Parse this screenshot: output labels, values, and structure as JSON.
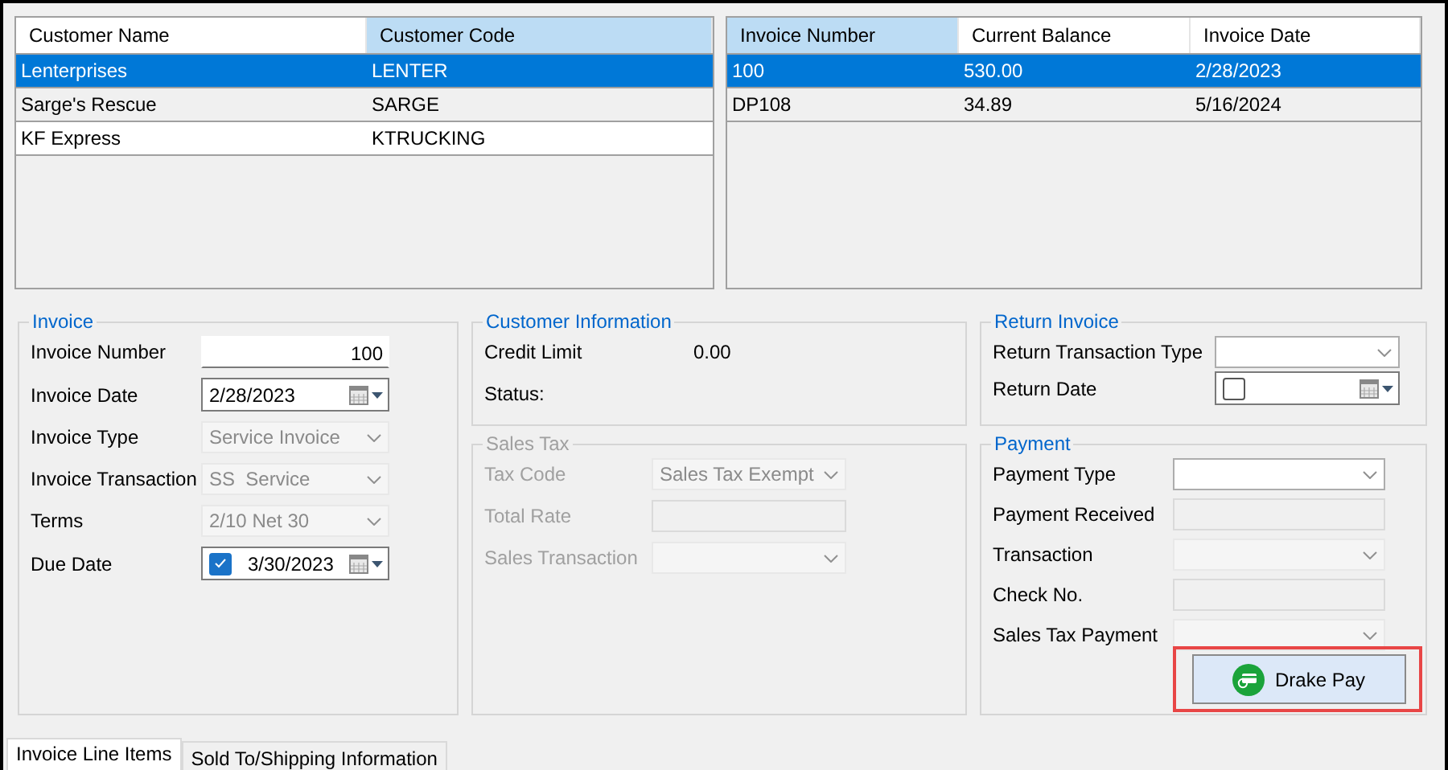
{
  "customer_grid": {
    "columns": [
      {
        "label": "Customer Name",
        "selected": false
      },
      {
        "label": "Customer Code",
        "selected": true
      }
    ],
    "rows": [
      {
        "cells": [
          "Lenterprises",
          "LENTER"
        ],
        "selected": true
      },
      {
        "cells": [
          "Sarge's Rescue",
          "SARGE"
        ],
        "selected": false
      },
      {
        "cells": [
          "KF Express",
          "KTRUCKING"
        ],
        "selected": false
      }
    ]
  },
  "invoice_grid": {
    "columns": [
      {
        "label": "Invoice Number",
        "selected": true
      },
      {
        "label": "Current Balance",
        "selected": false
      },
      {
        "label": "Invoice Date",
        "selected": false
      }
    ],
    "rows": [
      {
        "cells": [
          "100",
          "530.00",
          "2/28/2023"
        ],
        "selected": true
      },
      {
        "cells": [
          "DP108",
          "34.89",
          "5/16/2024"
        ],
        "selected": false
      }
    ]
  },
  "invoice": {
    "title": "Invoice",
    "disabled": false,
    "fields": [
      {
        "label": "Invoice Number",
        "kind": "text",
        "value": "100",
        "disabled": false
      },
      {
        "label": "Invoice Date",
        "kind": "date",
        "value": "2/28/2023",
        "disabled": false
      },
      {
        "label": "Invoice Type",
        "kind": "combo",
        "value": "Service Invoice",
        "disabled": true
      },
      {
        "label": "Invoice Transaction",
        "kind": "combo",
        "value": "SS  Service",
        "disabled": true
      },
      {
        "label": "Terms",
        "kind": "combo",
        "value": "2/10 Net 30",
        "disabled": true
      },
      {
        "label": "Due Date",
        "kind": "date",
        "value": "3/30/2023",
        "checked": true,
        "disabled": false
      }
    ]
  },
  "customer_information": {
    "title": "Customer Information",
    "disabled": false,
    "fields": [
      {
        "label": "Credit Limit",
        "kind": "value",
        "value": "0.00"
      },
      {
        "label": "Status:",
        "kind": "value"
      }
    ]
  },
  "sales_tax": {
    "title": "Sales Tax",
    "disabled": true,
    "fields": [
      {
        "label": "Tax Code",
        "kind": "combo",
        "value": "Sales Tax Exempt",
        "disabled": true
      },
      {
        "label": "Total Rate",
        "kind": "text",
        "disabled": true
      },
      {
        "label": "Sales Transaction",
        "kind": "combo",
        "disabled": true
      }
    ]
  },
  "return_invoice": {
    "title": "Return Invoice",
    "disabled": false,
    "fields": [
      {
        "label": "Return Transaction Type",
        "kind": "combo",
        "disabled": false
      },
      {
        "label": "Return Date",
        "kind": "date",
        "checked": false,
        "disabled": false
      }
    ]
  },
  "payment": {
    "title": "Payment",
    "disabled": false,
    "fields": [
      {
        "label": "Payment Type",
        "kind": "combo",
        "disabled": false
      },
      {
        "label": "Payment Received",
        "kind": "text",
        "disabled": true
      },
      {
        "label": "Transaction",
        "kind": "combo",
        "disabled": true
      },
      {
        "label": "Check No.",
        "kind": "text",
        "disabled": true
      },
      {
        "label": "Sales Tax Payment",
        "kind": "combo",
        "disabled": true
      }
    ],
    "button": {
      "label": "Drake Pay",
      "highlighted": true
    }
  },
  "tabs": [
    {
      "label": "Invoice Line Items",
      "selected": true
    },
    {
      "label": "Sold To/Shipping Information",
      "selected": false
    }
  ]
}
